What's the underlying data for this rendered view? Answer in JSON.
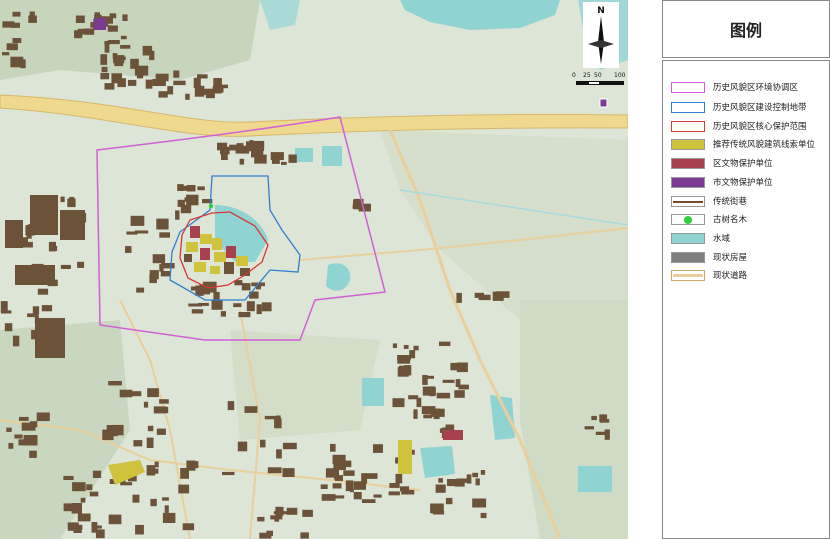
{
  "legend": {
    "title": "图例",
    "items": [
      {
        "label": "历史风貌区环境协调区",
        "kind": "outline",
        "color": "#d35fd6"
      },
      {
        "label": "历史风貌区建设控制地带",
        "kind": "outline",
        "color": "#2f7fcf"
      },
      {
        "label": "历史风貌区核心保护范围",
        "kind": "outline",
        "color": "#d93636"
      },
      {
        "label": "推荐传统风貌建筑线索单位",
        "kind": "fill",
        "color": "#cfc23d"
      },
      {
        "label": "区文物保护单位",
        "kind": "fill",
        "color": "#a8414f"
      },
      {
        "label": "市文物保护单位",
        "kind": "fill",
        "color": "#7b3a93"
      },
      {
        "label": "传统街巷",
        "kind": "street",
        "color": "#7a4b2a"
      },
      {
        "label": "古树名木",
        "kind": "tree",
        "color": "#2fcf3a"
      },
      {
        "label": "水域",
        "kind": "fill",
        "color": "#8fd3d3"
      },
      {
        "label": "现状房屋",
        "kind": "fill",
        "color": "#7f7f7f"
      },
      {
        "label": "现状道路",
        "kind": "road",
        "color": "#e8cf9c"
      }
    ]
  },
  "north": {
    "label": "N",
    "icon": "north-arrow-icon"
  },
  "scale": {
    "labels": [
      "0",
      "25",
      "50",
      "100"
    ]
  },
  "colors": {
    "road_fill": "#efd98e",
    "road_edge": "#d6b76a",
    "building": "#6b5238",
    "water": "#8fd3d3",
    "field": "#dfe6d8",
    "vegetation": "#c9d6bd"
  }
}
